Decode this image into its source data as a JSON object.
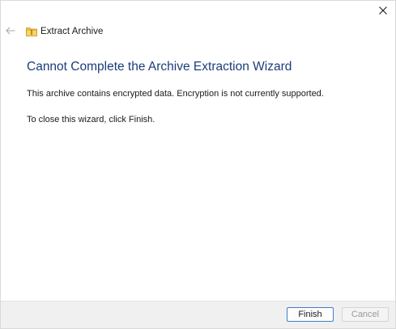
{
  "nav": {
    "title": "Extract Archive"
  },
  "content": {
    "heading": "Cannot Complete the Archive Extraction Wizard",
    "message": "This archive contains encrypted data. Encryption is not currently supported.",
    "instruction": "To close this wizard, click Finish."
  },
  "buttons": {
    "finish": "Finish",
    "cancel": "Cancel"
  },
  "icons": {
    "close": "close-icon",
    "back": "back-arrow-icon",
    "folder": "zip-folder-icon"
  },
  "colors": {
    "heading": "#1b3d7a",
    "primary_button_border": "#3c7fc9",
    "footer_bg": "#f0f0f0",
    "disabled_text": "#9a9a9a"
  }
}
